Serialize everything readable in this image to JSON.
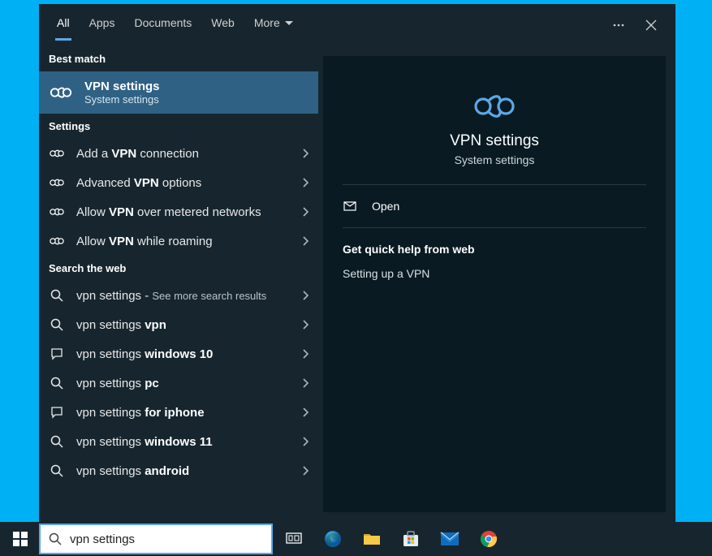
{
  "tabs": {
    "items": [
      "All",
      "Apps",
      "Documents",
      "Web",
      "More"
    ],
    "active": 0
  },
  "sections": {
    "best_match": "Best match",
    "settings": "Settings",
    "web": "Search the web"
  },
  "best_match": {
    "title": "VPN settings",
    "subtitle": "System settings"
  },
  "settings_results": [
    {
      "prefix": "Add a ",
      "bold": "VPN",
      "suffix": " connection"
    },
    {
      "prefix": "Advanced ",
      "bold": "VPN",
      "suffix": " options"
    },
    {
      "prefix": "Allow ",
      "bold": "VPN",
      "suffix": " over metered networks"
    },
    {
      "prefix": "Allow ",
      "bold": "VPN",
      "suffix": " while roaming"
    }
  ],
  "web_results": [
    {
      "text": "vpn settings",
      "suffix": " - ",
      "more": "See more search results",
      "icon": "search"
    },
    {
      "text": "vpn settings ",
      "bold": "vpn",
      "icon": "search"
    },
    {
      "text": "vpn settings ",
      "bold": "windows 10",
      "icon": "chat"
    },
    {
      "text": "vpn settings ",
      "bold": "pc",
      "icon": "search"
    },
    {
      "text": "vpn settings ",
      "bold": "for iphone",
      "icon": "chat"
    },
    {
      "text": "vpn settings ",
      "bold": "windows 11",
      "icon": "search"
    },
    {
      "text": "vpn settings ",
      "bold": "android",
      "icon": "search"
    }
  ],
  "preview": {
    "title": "VPN settings",
    "subtitle": "System settings",
    "open": "Open",
    "help_heading": "Get quick help from web",
    "help_links": [
      "Setting up a VPN"
    ]
  },
  "search_value": "vpn settings"
}
